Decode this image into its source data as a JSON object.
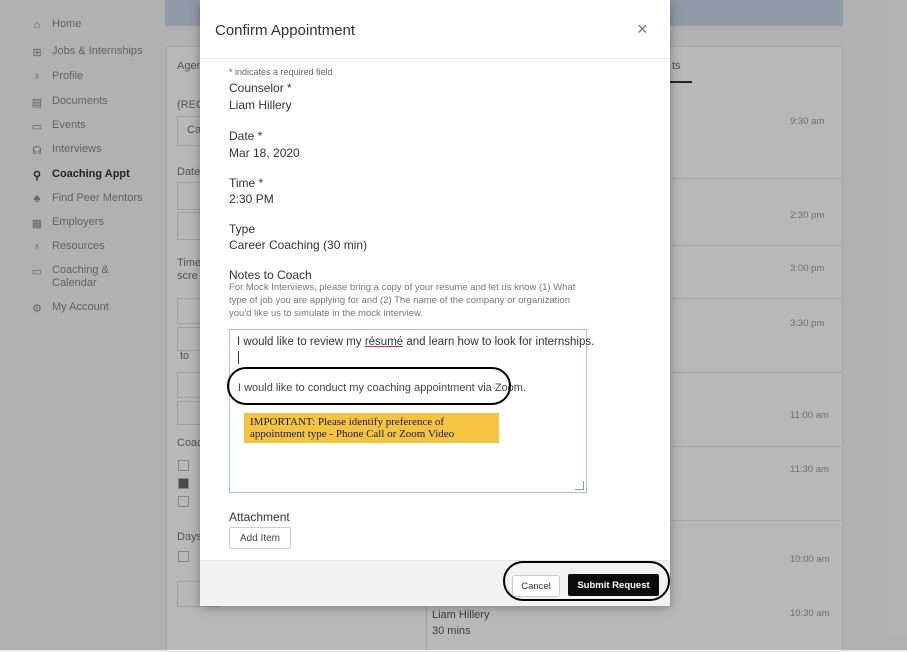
{
  "sidebar": {
    "items": [
      {
        "label": "Home",
        "icon": "home-icon",
        "glyph": "⌂",
        "active": false
      },
      {
        "label": "Jobs & Internships",
        "icon": "briefcase-icon",
        "glyph": "⊞",
        "active": false
      },
      {
        "label": "Profile",
        "icon": "user-icon",
        "glyph": "♀",
        "active": false
      },
      {
        "label": "Documents",
        "icon": "document-icon",
        "glyph": "▤",
        "active": false
      },
      {
        "label": "Events",
        "icon": "calendar-icon",
        "glyph": "▭",
        "active": false
      },
      {
        "label": "Interviews",
        "icon": "interview-icon",
        "glyph": "☊",
        "active": false
      },
      {
        "label": "Coaching Appt",
        "icon": "coaching-icon",
        "glyph": "⚲",
        "active": true
      },
      {
        "label": "Find Peer Mentors",
        "icon": "mentors-icon",
        "glyph": "♣",
        "active": false
      },
      {
        "label": "Employers",
        "icon": "building-icon",
        "glyph": "▦",
        "active": false
      },
      {
        "label": "Resources",
        "icon": "lightbulb-icon",
        "glyph": "♁",
        "active": false
      },
      {
        "label": "Coaching & Calendar",
        "icon": "calendar-icon",
        "glyph": "▭",
        "active": false
      },
      {
        "label": "My Account",
        "icon": "gear-icon",
        "glyph": "⚙",
        "active": false
      }
    ]
  },
  "background": {
    "left_fragments": [
      "Agen",
      "(REC",
      "Ca",
      "Date",
      "2",
      "2",
      "Time",
      "scre",
      "C",
      "to",
      "C",
      "Coac",
      "A",
      "Li",
      "Vi",
      "Days",
      "M",
      "Re"
    ],
    "right_tab": "ts",
    "times": [
      "9:30 am",
      "2:30 pm",
      "3:00 pm",
      "3:30 pm",
      "11:00 am",
      "11:30 am",
      "10:00 am",
      "10:30 am"
    ],
    "bottom_name": "Liam Hillery",
    "bottom_duration": "30 mins"
  },
  "modal": {
    "title": "Confirm Appointment",
    "close_glyph": "×",
    "required_note": "* indicates a required field",
    "counselor_label": "Counselor *",
    "counselor_value": "Liam Hillery",
    "date_label": "Date *",
    "date_value": "Mar 18, 2020",
    "time_label": "Time *",
    "time_value": "2:30 PM",
    "type_label": "Type",
    "type_value": "Career Coaching (30 min)",
    "notes_label": "Notes to Coach",
    "notes_help": "For Mock Interviews, please bring a copy of your resume and let us know (1) What type of job you are applying for and (2) The name of the company or organization you'd like us to simulate in the mock interview.",
    "notes_line1_a": "I would like to review my ",
    "notes_line1_b": "résumé",
    "notes_line1_c": " and learn how to look for internships.",
    "notes_line2": "I would like to conduct my coaching appointment via Zoom.",
    "important_note": "IMPORTANT: Please identify preference of appointment type - Phone Call or Zoom Video",
    "attachment_label": "Attachment",
    "add_item_label": "Add Item",
    "cancel_label": "Cancel",
    "submit_label": "Submit Request"
  }
}
